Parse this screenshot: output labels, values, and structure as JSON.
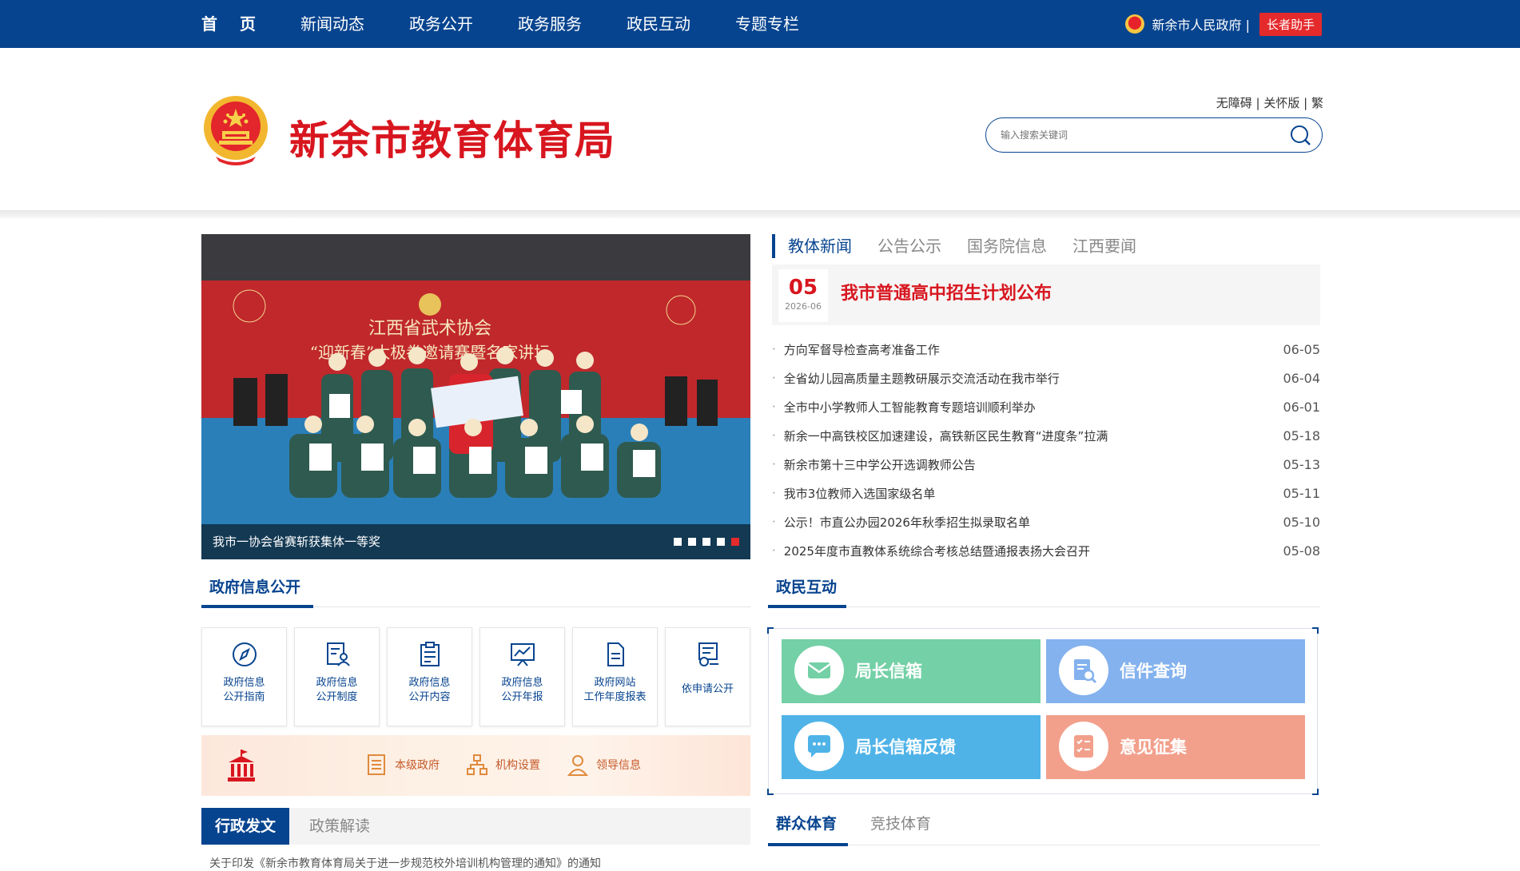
{
  "nav": {
    "items": [
      "首页",
      "新闻动态",
      "政务公开",
      "政务服务",
      "政民互动",
      "专题专栏"
    ],
    "gov_link": "新余市人民政府 |",
    "helper": "长者助手"
  },
  "header": {
    "title": "新余市教育体育局",
    "access_links": [
      "无障碍",
      "关怀版",
      "繁"
    ],
    "search_placeholder": "输入搜索关键词"
  },
  "slide": {
    "banner_line1": "江西省武术协会",
    "banner_line2": "“迎新春”太极拳邀请赛暨名家讲坛",
    "caption": "我市一协会省赛斩获集体一等奖",
    "dot_count": 5,
    "active_dot": 4
  },
  "news": {
    "tabs": [
      "教体新闻",
      "公告公示",
      "国务院信息",
      "江西要闻"
    ],
    "headline": {
      "day": "05",
      "year_month": "2026-06",
      "title": "我市普通高中招生计划公布"
    },
    "items": [
      {
        "title": "方向军督导检查高考准备工作",
        "date": "06-05"
      },
      {
        "title": "全省幼儿园高质量主题教研展示交流活动在我市举行",
        "date": "06-04"
      },
      {
        "title": "全市中小学教师人工智能教育专题培训顺利举办",
        "date": "06-01"
      },
      {
        "title": "新余一中高铁校区加速建设，高铁新区民生教育“进度条”拉满",
        "date": "05-18"
      },
      {
        "title": "新余市第十三中学公开选调教师公告",
        "date": "05-13"
      },
      {
        "title": "我市3位教师入选国家级名单",
        "date": "05-11"
      },
      {
        "title": "公示！市直公办园2026年秋季招生拟录取名单",
        "date": "05-10"
      },
      {
        "title": "2025年度市直教体系统综合考核总结暨通报表扬大会召开",
        "date": "05-08"
      }
    ]
  },
  "gov_info": {
    "title": "政府信息公开",
    "cards": [
      {
        "l1": "政府信息",
        "l2": "公开指南",
        "icon": "compass-icon"
      },
      {
        "l1": "政府信息",
        "l2": "公开制度",
        "icon": "document-person-icon"
      },
      {
        "l1": "政府信息",
        "l2": "公开内容",
        "icon": "clipboard-icon"
      },
      {
        "l1": "政府信息",
        "l2": "公开年报",
        "icon": "chart-board-icon"
      },
      {
        "l1": "政府网站",
        "l2": "工作年度报表",
        "icon": "file-icon"
      },
      {
        "l1": "依申请公开",
        "l2": "",
        "icon": "certificate-icon"
      }
    ],
    "strip_links": [
      "本级政府",
      "机构设置",
      "领导信息"
    ]
  },
  "docs": {
    "tabs": [
      "行政发文",
      "政策解读"
    ],
    "peek_text": "关于印发《新余市教育体育局关于进一步规范校外培训机构管理的通知》的通知"
  },
  "interaction": {
    "title": "政民互动",
    "tiles": [
      {
        "label": "局长信箱",
        "color": "#74d0a6",
        "icon": "mail-icon"
      },
      {
        "label": "信件查询",
        "color": "#84b2ee",
        "icon": "search-doc-icon"
      },
      {
        "label": "局长信箱反馈",
        "color": "#4fb3e8",
        "icon": "chat-bubble-icon"
      },
      {
        "label": "意见征集",
        "color": "#f2a08c",
        "icon": "checklist-icon"
      }
    ]
  },
  "sports": {
    "tabs": [
      "群众体育",
      "竞技体育"
    ]
  },
  "colors": {
    "primary": "#07448f",
    "accent_red": "#d8161f"
  }
}
